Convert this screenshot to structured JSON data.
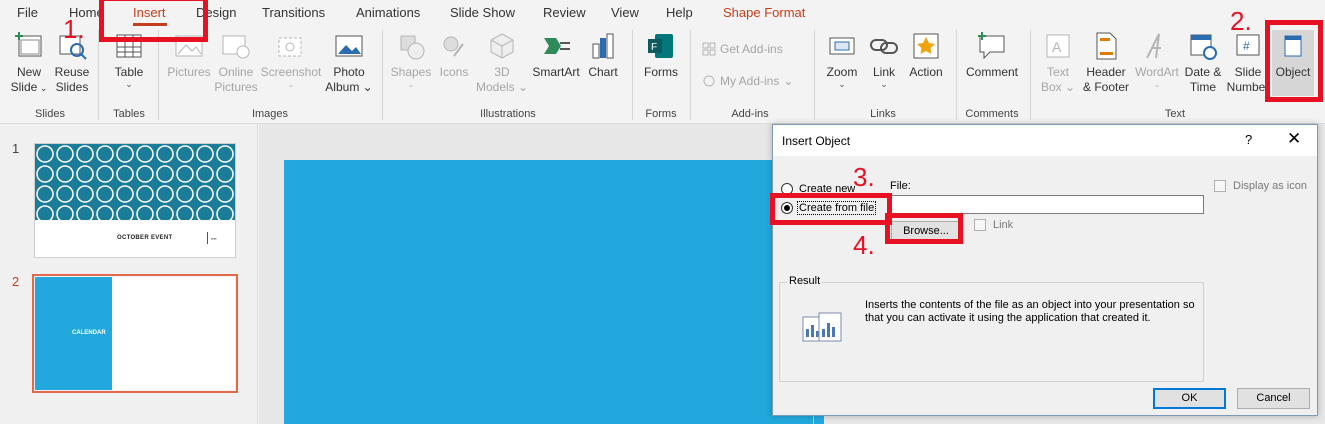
{
  "tabs": [
    "File",
    "Home",
    "Insert",
    "Design",
    "Transitions",
    "Animations",
    "Slide Show",
    "Review",
    "View",
    "Help",
    "Shape Format"
  ],
  "ribbon": {
    "slides": {
      "new_slide": "New Slide",
      "new_slide_l1": "New",
      "new_slide_l2": "Slide",
      "reuse_l1": "Reuse",
      "reuse_l2": "Slides",
      "group": "Slides"
    },
    "tables": {
      "table": "Table",
      "group": "Tables"
    },
    "images": {
      "pictures": "Pictures",
      "online_l1": "Online",
      "online_l2": "Pictures",
      "screenshot": "Screenshot",
      "photo_l1": "Photo",
      "photo_l2": "Album",
      "group": "Images"
    },
    "illustrations": {
      "shapes": "Shapes",
      "icons": "Icons",
      "models_l1": "3D",
      "models_l2": "Models",
      "smartart": "SmartArt",
      "chart": "Chart",
      "group": "Illustrations"
    },
    "forms": {
      "forms": "Forms",
      "group": "Forms"
    },
    "addins": {
      "get": "Get Add-ins",
      "my": "My Add-ins",
      "group": "Add-ins"
    },
    "links": {
      "zoom": "Zoom",
      "link": "Link",
      "action": "Action",
      "group": "Links"
    },
    "comments": {
      "comment": "Comment",
      "group": "Comments"
    },
    "text": {
      "textbox_l1": "Text",
      "textbox_l2": "Box",
      "hf_l1": "Header",
      "hf_l2": "& Footer",
      "wordart": "WordArt",
      "dt_l1": "Date &",
      "dt_l2": "Time",
      "sn_l1": "Slide",
      "sn_l2": "Number",
      "object": "Object",
      "group": "Text"
    }
  },
  "annotations": {
    "n1": "1.",
    "n2": "2.",
    "n3": "3.",
    "n4": "4."
  },
  "thumbnails": {
    "n1": "1",
    "n2": "2",
    "slide1_title": "OCTOBER EVENT",
    "slide2_title": "CALENDAR"
  },
  "dialog": {
    "title": "Insert Object",
    "help": "?",
    "close": "✕",
    "create_new": "Create new",
    "create_from_file": "Create from file",
    "file_label": "File:",
    "file_value": "",
    "browse": "Browse...",
    "link": "Link",
    "display_as_icon": "Display as icon",
    "result_label": "Result",
    "result_text": "Inserts the contents of the file as an object into your presentation so that you can activate it using the application that created it.",
    "ok": "OK",
    "cancel": "Cancel"
  },
  "colors": {
    "accent": "#c43e1c",
    "annotation": "#e81123",
    "slide_blue": "#22a8dc",
    "pattern_teal": "#1a7c98"
  }
}
